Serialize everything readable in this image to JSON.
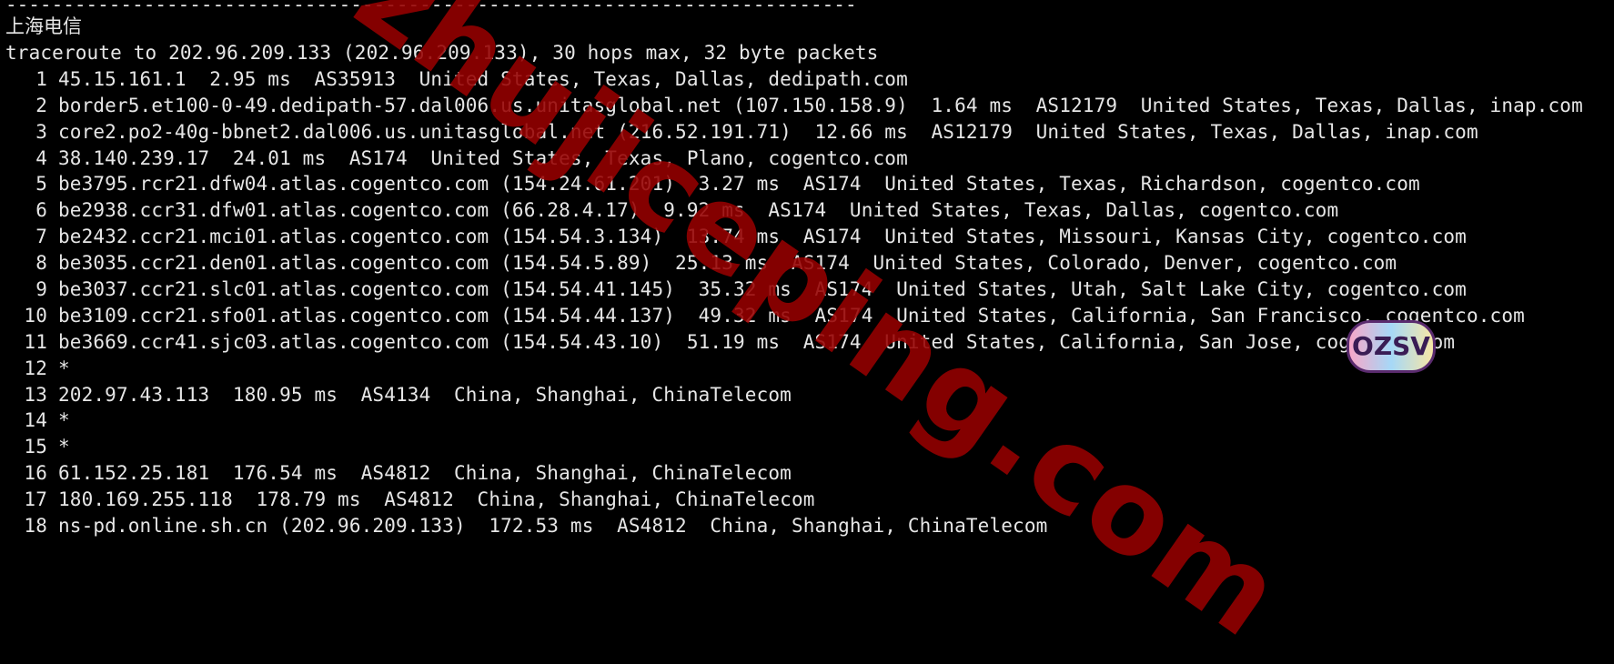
{
  "separator": "--------------------------------------------------------------------------",
  "heading": "上海电信",
  "command_line": "traceroute to 202.96.209.133 (202.96.209.133), 30 hops max, 32 byte packets",
  "hops": [
    {
      "n": "1",
      "text": "45.15.161.1  2.95 ms  AS35913  United States, Texas, Dallas, dedipath.com"
    },
    {
      "n": "2",
      "text": "border5.et100-0-49.dedipath-57.dal006.us.unitasglobal.net (107.150.158.9)  1.64 ms  AS12179  United States, Texas, Dallas, inap.com"
    },
    {
      "n": "3",
      "text": "core2.po2-40g-bbnet2.dal006.us.unitasglobal.net (216.52.191.71)  12.66 ms  AS12179  United States, Texas, Dallas, inap.com"
    },
    {
      "n": "4",
      "text": "38.140.239.17  24.01 ms  AS174  United States, Texas, Plano, cogentco.com"
    },
    {
      "n": "5",
      "text": "be3795.rcr21.dfw04.atlas.cogentco.com (154.24.61.201)  3.27 ms  AS174  United States, Texas, Richardson, cogentco.com"
    },
    {
      "n": "6",
      "text": "be2938.ccr31.dfw01.atlas.cogentco.com (66.28.4.17)  9.92 ms  AS174  United States, Texas, Dallas, cogentco.com"
    },
    {
      "n": "7",
      "text": "be2432.ccr21.mci01.atlas.cogentco.com (154.54.3.134)  13.74 ms  AS174  United States, Missouri, Kansas City, cogentco.com"
    },
    {
      "n": "8",
      "text": "be3035.ccr21.den01.atlas.cogentco.com (154.54.5.89)  25.13 ms  AS174  United States, Colorado, Denver, cogentco.com"
    },
    {
      "n": "9",
      "text": "be3037.ccr21.slc01.atlas.cogentco.com (154.54.41.145)  35.32 ms  AS174  United States, Utah, Salt Lake City, cogentco.com"
    },
    {
      "n": "10",
      "text": "be3109.ccr21.sfo01.atlas.cogentco.com (154.54.44.137)  49.32 ms  AS174  United States, California, San Francisco, cogentco.com"
    },
    {
      "n": "11",
      "text": "be3669.ccr41.sjc03.atlas.cogentco.com (154.54.43.10)  51.19 ms  AS174  United States, California, San Jose, cogentco.com"
    },
    {
      "n": "12",
      "text": "*"
    },
    {
      "n": "13",
      "text": "202.97.43.113  180.95 ms  AS4134  China, Shanghai, ChinaTelecom"
    },
    {
      "n": "14",
      "text": "*"
    },
    {
      "n": "15",
      "text": "*"
    },
    {
      "n": "16",
      "text": "61.152.25.181  176.54 ms  AS4812  China, Shanghai, ChinaTelecom"
    },
    {
      "n": "17",
      "text": "180.169.255.118  178.79 ms  AS4812  China, Shanghai, ChinaTelecom"
    },
    {
      "n": "18",
      "text": "ns-pd.online.sh.cn (202.96.209.133)  172.53 ms  AS4812  China, Shanghai, ChinaTelecom"
    }
  ],
  "watermark": "zhujiceping.com",
  "badge": "OZSV",
  "colors": {
    "background": "#000000",
    "text": "#e6e6e6",
    "watermark": "#960000"
  }
}
